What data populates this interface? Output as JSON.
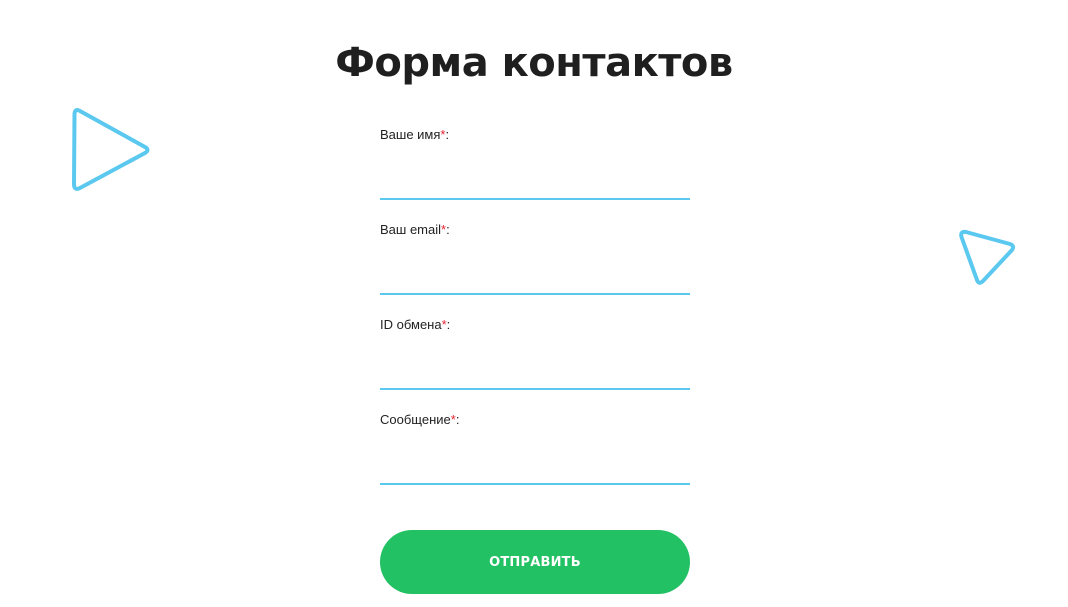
{
  "page": {
    "title": "Форма контактов"
  },
  "form": {
    "fields": [
      {
        "label": "Ваше имя",
        "required_mark": "*",
        "suffix": ":",
        "value": ""
      },
      {
        "label": "Ваш email",
        "required_mark": "*",
        "suffix": ":",
        "value": ""
      },
      {
        "label": "ID обмена",
        "required_mark": "*",
        "suffix": ":",
        "value": ""
      },
      {
        "label": "Сообщение",
        "required_mark": "*",
        "suffix": ":",
        "value": ""
      }
    ],
    "submit_label": "ОТПРАВИТЬ"
  },
  "decorations": {
    "left_icon": "play-triangle-icon",
    "right_icon": "play-triangle-icon"
  },
  "colors": {
    "accent_blue": "#5bc8ef",
    "button_green": "#22c163",
    "required_red": "#e5222f",
    "text_dark": "#222222"
  }
}
